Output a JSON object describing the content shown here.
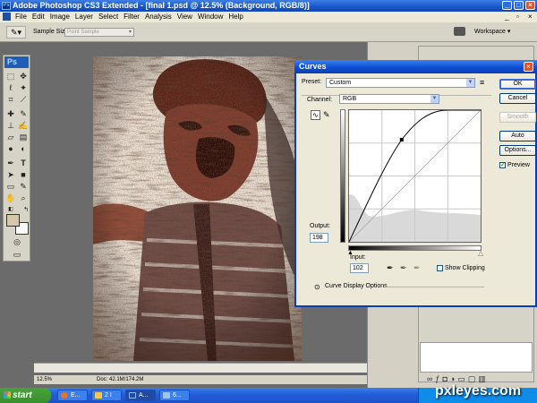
{
  "window": {
    "title": "Adobe Photoshop CS3 Extended - [final 1.psd @ 12.5% (Background, RGB/8)]",
    "ps_badge": "Ps"
  },
  "menu": [
    "File",
    "Edit",
    "Image",
    "Layer",
    "Select",
    "Filter",
    "Analysis",
    "View",
    "Window",
    "Help"
  ],
  "options_bar": {
    "sample_size_label": "Sample Size:",
    "sample_size_value": "Point Sample",
    "workspace_label": "Workspace ▾"
  },
  "toolbox": {
    "logo": "Ps",
    "foreground_color": "#d5c7ab",
    "background_color": "#ffffff"
  },
  "document": {
    "zoom": "12.5%",
    "doc_size": "Doc: 42.1M/174.2M"
  },
  "curves": {
    "title": "Curves",
    "preset_label": "Preset:",
    "preset_value": "Custom",
    "channel_label": "Channel:",
    "channel_value": "RGB",
    "output_label": "Output:",
    "output_value": "198",
    "input_label": "Input:",
    "input_value": "102",
    "show_clipping_label": "Show Clipping",
    "curve_display_options": "Curve Display Options",
    "buttons": {
      "ok": "OK",
      "cancel": "Cancel",
      "smooth": "Smooth",
      "auto": "Auto",
      "options": "Options..."
    },
    "preview_label": "Preview",
    "preview_checked": true,
    "show_clipping_checked": false
  },
  "taskbar": {
    "start": "start",
    "tasks": [
      "E...",
      "2 I",
      "A...",
      "6..."
    ]
  },
  "watermark": "pxleyes.com"
}
